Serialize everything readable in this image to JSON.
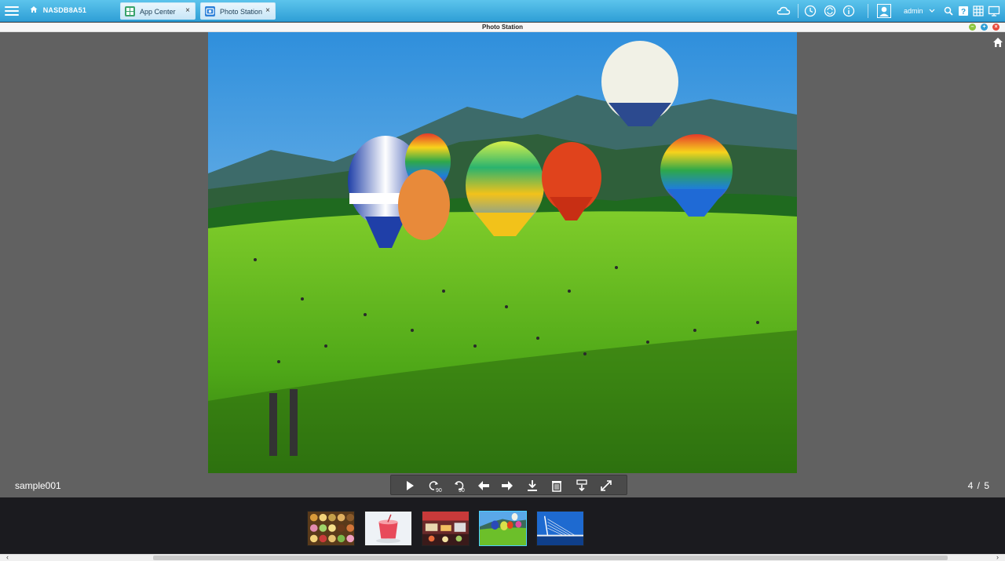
{
  "taskbar": {
    "nas_name": "NASDB8A51",
    "tabs": [
      {
        "label": "App Center",
        "close": "×"
      },
      {
        "label": "Photo Station",
        "close": "×"
      }
    ],
    "user": "admin"
  },
  "window": {
    "title": "Photo Station"
  },
  "viewer": {
    "filename": "sample001",
    "counter": "4 / 5",
    "controls": [
      "play-icon",
      "rotate-left-90-icon",
      "rotate-right-90-icon",
      "previous-arrow-icon",
      "next-arrow-icon",
      "download-icon",
      "delete-icon",
      "set-cover-icon",
      "fullscreen-icon"
    ],
    "rotate_label": "90"
  },
  "filmstrip": {
    "thumbnails": [
      {
        "subject": "macarons"
      },
      {
        "subject": "dessert-cup"
      },
      {
        "subject": "market-stall"
      },
      {
        "subject": "hot-air-balloons",
        "selected": true
      },
      {
        "subject": "bridge-at-night"
      }
    ]
  },
  "colors": {
    "taskbar_top": "#5cc4ec",
    "taskbar_bottom": "#2f9fd6",
    "viewer_bg": "#616161",
    "filmstrip_bg": "#1b1b1f",
    "selected_border": "#4bd0ff"
  }
}
